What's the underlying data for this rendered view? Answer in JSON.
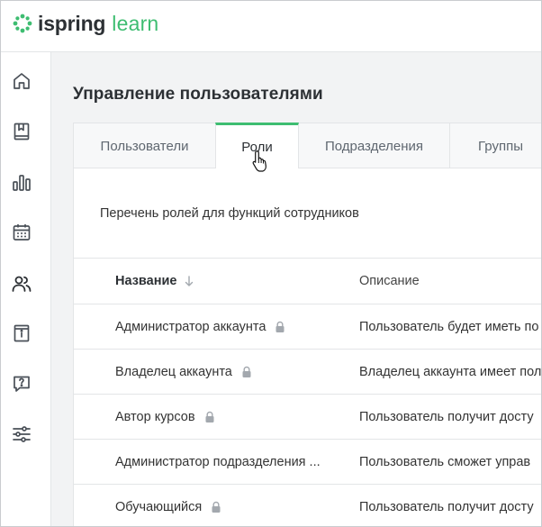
{
  "brand": {
    "name_part1": "ispring",
    "name_part2": "learn",
    "accent": "#3ebd71"
  },
  "sidebar": {
    "items": [
      {
        "icon": "home-icon"
      },
      {
        "icon": "book-icon"
      },
      {
        "icon": "bar-chart-icon"
      },
      {
        "icon": "calendar-icon"
      },
      {
        "icon": "users-icon",
        "active": true
      },
      {
        "icon": "info-card-icon"
      },
      {
        "icon": "help-icon"
      },
      {
        "icon": "settings-sliders-icon"
      }
    ]
  },
  "page": {
    "title": "Управление пользователями",
    "subtitle": "Перечень ролей для функций сотрудников"
  },
  "tabs": [
    {
      "label": "Пользователи"
    },
    {
      "label": "Роли",
      "active": true
    },
    {
      "label": "Подразделения"
    },
    {
      "label": "Группы"
    }
  ],
  "table": {
    "headers": {
      "name": "Название",
      "description": "Описание"
    },
    "rows": [
      {
        "name": "Администратор аккаунта",
        "locked": true,
        "description": "Пользователь будет иметь по"
      },
      {
        "name": "Владелец аккаунта",
        "locked": true,
        "description": "Владелец аккаунта имеет пол"
      },
      {
        "name": "Автор курсов",
        "locked": true,
        "description": "Пользователь получит досту"
      },
      {
        "name": "Администратор подразделения ...",
        "locked": false,
        "description": "Пользователь сможет управ"
      },
      {
        "name": "Обучающийся",
        "locked": true,
        "description": "Пользователь получит досту"
      }
    ]
  }
}
